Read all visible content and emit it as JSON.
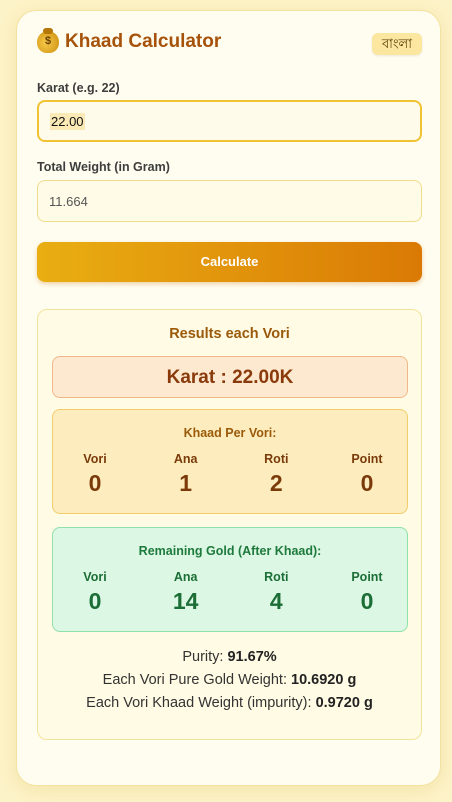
{
  "header": {
    "title": "Khaad Calculator",
    "language_toggle": "বাংলা",
    "icon": "money-bag-icon"
  },
  "form": {
    "karat_label": "Karat (e.g. 22)",
    "karat_value": "22.00",
    "weight_label": "Total Weight (in Gram)",
    "weight_value": "11.664",
    "calculate_label": "Calculate"
  },
  "results": {
    "title": "Results each Vori",
    "karat_display": "Karat : 22.00K",
    "khaad": {
      "title": "Khaad Per Vori:",
      "units": [
        {
          "label": "Vori",
          "value": "0"
        },
        {
          "label": "Ana",
          "value": "1"
        },
        {
          "label": "Roti",
          "value": "2"
        },
        {
          "label": "Point",
          "value": "0"
        }
      ]
    },
    "remaining": {
      "title": "Remaining Gold (After Khaad):",
      "units": [
        {
          "label": "Vori",
          "value": "0"
        },
        {
          "label": "Ana",
          "value": "14"
        },
        {
          "label": "Roti",
          "value": "4"
        },
        {
          "label": "Point",
          "value": "0"
        }
      ]
    },
    "purity_label": "Purity: ",
    "purity_value": "91.67%",
    "pure_gold_label": "Each Vori Pure Gold Weight: ",
    "pure_gold_value": "10.6920 g",
    "khaad_weight_label": "Each Vori Khaad Weight (impurity): ",
    "khaad_weight_value": "0.9720 g"
  },
  "colors": {
    "accent": "#da7a05",
    "title": "#a6520a",
    "remaining": "#1b6e35"
  }
}
